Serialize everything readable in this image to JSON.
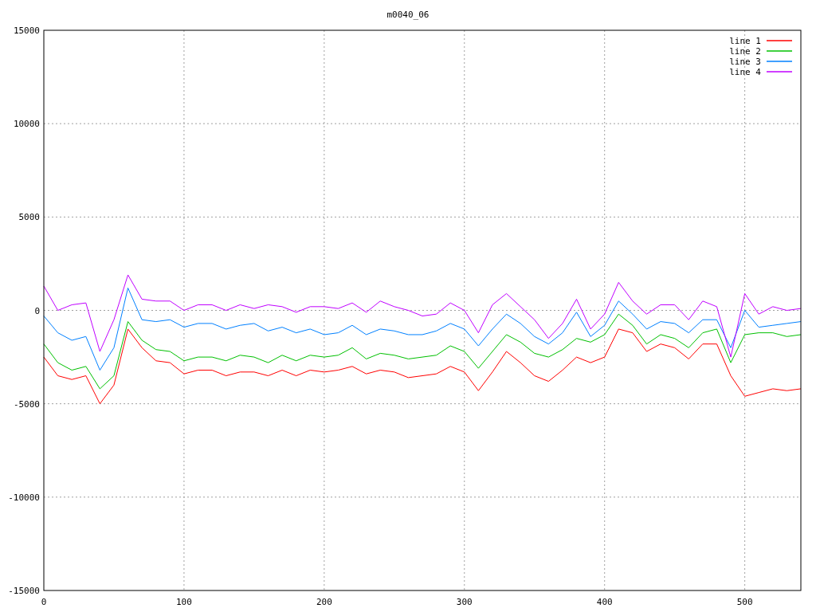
{
  "chart_data": {
    "type": "line",
    "title": "m0040_06",
    "x": [
      0,
      10,
      20,
      30,
      40,
      50,
      60,
      70,
      80,
      90,
      100,
      110,
      120,
      130,
      140,
      150,
      160,
      170,
      180,
      190,
      200,
      210,
      220,
      230,
      240,
      250,
      260,
      270,
      280,
      290,
      300,
      310,
      320,
      330,
      340,
      350,
      360,
      370,
      380,
      390,
      400,
      410,
      420,
      430,
      440,
      450,
      460,
      470,
      480,
      490,
      500,
      510,
      520,
      530,
      540
    ],
    "series": [
      {
        "name": "line 1",
        "color": "#ff0000",
        "values": [
          -2500,
          -3500,
          -3700,
          -3500,
          -5000,
          -4000,
          -1000,
          -2000,
          -2700,
          -2800,
          -3400,
          -3200,
          -3200,
          -3500,
          -3300,
          -3300,
          -3500,
          -3200,
          -3500,
          -3200,
          -3300,
          -3200,
          -3000,
          -3400,
          -3200,
          -3300,
          -3600,
          -3500,
          -3400,
          -3000,
          -3300,
          -4300,
          -3300,
          -2200,
          -2800,
          -3500,
          -3800,
          -3200,
          -2500,
          -2800,
          -2500,
          -1000,
          -1200,
          -2200,
          -1800,
          -2000,
          -2600,
          -1800,
          -1800,
          -3500,
          -4600,
          -4400,
          -4200,
          -4300,
          -4200
        ]
      },
      {
        "name": "line 2",
        "color": "#00c000",
        "values": [
          -1800,
          -2800,
          -3200,
          -3000,
          -4200,
          -3500,
          -600,
          -1600,
          -2100,
          -2200,
          -2700,
          -2500,
          -2500,
          -2700,
          -2400,
          -2500,
          -2800,
          -2400,
          -2700,
          -2400,
          -2500,
          -2400,
          -2000,
          -2600,
          -2300,
          -2400,
          -2600,
          -2500,
          -2400,
          -1900,
          -2200,
          -3100,
          -2200,
          -1300,
          -1700,
          -2300,
          -2500,
          -2100,
          -1500,
          -1700,
          -1300,
          -200,
          -800,
          -1800,
          -1300,
          -1500,
          -2000,
          -1200,
          -1000,
          -2800,
          -1300,
          -1200,
          -1200,
          -1400,
          -1300
        ]
      },
      {
        "name": "line 3",
        "color": "#0080ff",
        "values": [
          -300,
          -1200,
          -1600,
          -1400,
          -3200,
          -2000,
          1200,
          -500,
          -600,
          -500,
          -900,
          -700,
          -700,
          -1000,
          -800,
          -700,
          -1100,
          -900,
          -1200,
          -1000,
          -1300,
          -1200,
          -800,
          -1300,
          -1000,
          -1100,
          -1300,
          -1300,
          -1100,
          -700,
          -1000,
          -1900,
          -1000,
          -200,
          -700,
          -1400,
          -1800,
          -1200,
          -100,
          -1400,
          -800,
          500,
          -200,
          -1000,
          -600,
          -700,
          -1200,
          -500,
          -500,
          -2000,
          0,
          -900,
          -800,
          -700,
          -600
        ]
      },
      {
        "name": "line 4",
        "color": "#c000ff",
        "values": [
          1300,
          0,
          300,
          400,
          -2200,
          -500,
          1900,
          600,
          500,
          500,
          0,
          300,
          300,
          0,
          300,
          100,
          300,
          200,
          -100,
          200,
          200,
          100,
          400,
          -100,
          500,
          200,
          0,
          -300,
          -200,
          400,
          0,
          -1200,
          300,
          900,
          200,
          -500,
          -1500,
          -700,
          600,
          -1000,
          -200,
          1500,
          500,
          -200,
          300,
          300,
          -500,
          500,
          200,
          -2500,
          900,
          -200,
          200,
          0,
          100
        ]
      }
    ],
    "xlim": [
      0,
      540
    ],
    "ylim": [
      -15000,
      15000
    ],
    "xticks": [
      0,
      100,
      200,
      300,
      400,
      500
    ],
    "yticks": [
      -15000,
      -10000,
      -5000,
      0,
      5000,
      10000,
      15000
    ],
    "grid": true,
    "legend": true
  }
}
